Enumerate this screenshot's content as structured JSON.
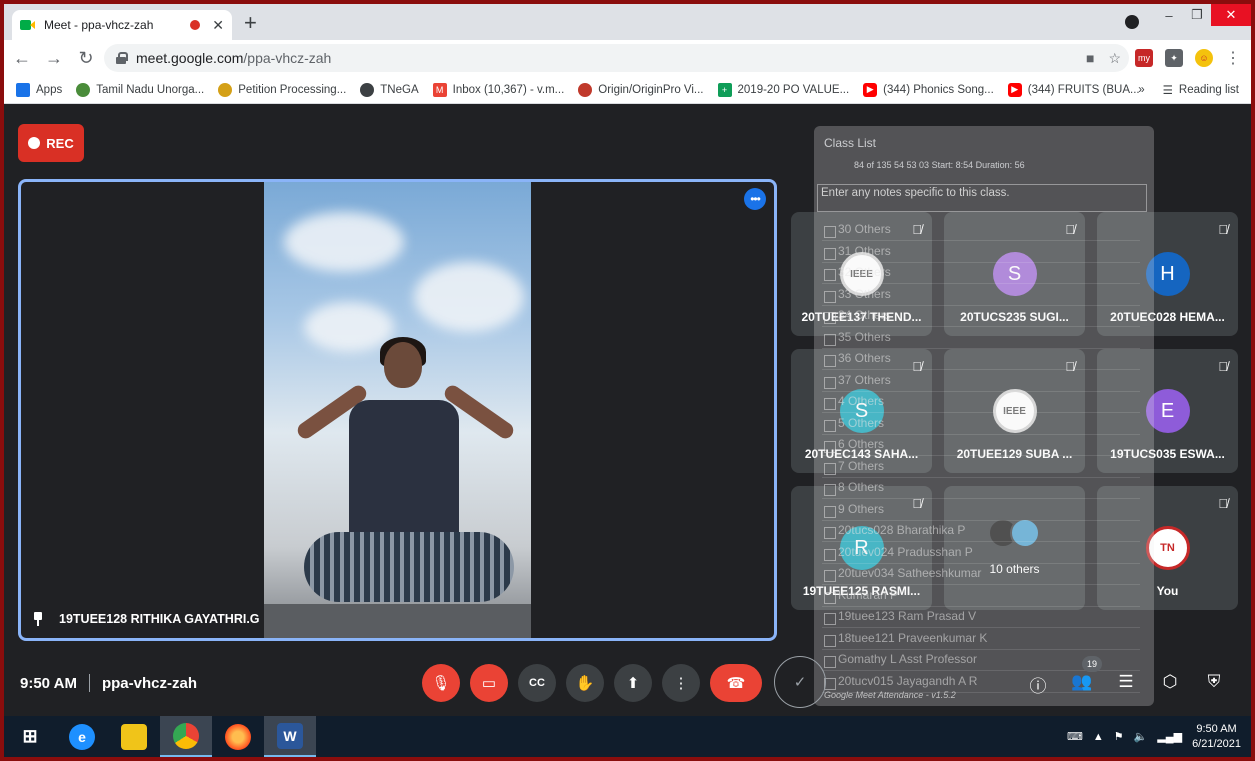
{
  "browser": {
    "tab_title": "Meet - ppa-vhcz-zah",
    "tab_close": "✕",
    "new_tab": "+",
    "url_host": "meet.google.com",
    "url_path": "/ppa-vhcz-zah",
    "win_min": "–",
    "win_max": "❐",
    "win_close": "✕",
    "nav_back": "←",
    "nav_forward": "→",
    "nav_reload": "↻",
    "omni_camera": "■",
    "omni_star": "☆",
    "menu_dots": "⋮"
  },
  "bookmarks": {
    "items": [
      {
        "label": "Apps",
        "icon": "apps-grid-icon",
        "color": "#1a73e8"
      },
      {
        "label": "Tamil Nadu Unorga...",
        "icon": "seal-icon",
        "color": "#4a8c3a"
      },
      {
        "label": "Petition Processing...",
        "icon": "seal-icon",
        "color": "#d4a017"
      },
      {
        "label": "TNeGA",
        "icon": "globe-icon",
        "color": "#3c4043"
      },
      {
        "label": "Inbox (10,367) - v.m...",
        "icon": "gmail-icon",
        "color": "#ea4335"
      },
      {
        "label": "Origin/OriginPro Vi...",
        "icon": "origin-icon",
        "color": "#c0392b"
      },
      {
        "label": "2019-20 PO VALUE...",
        "icon": "sheets-icon",
        "color": "#0f9d58"
      },
      {
        "label": "(344) Phonics Song...",
        "icon": "youtube-icon",
        "color": "#ff0000"
      },
      {
        "label": "(344) FRUITS (BUA...",
        "icon": "youtube-icon",
        "color": "#ff0000"
      }
    ],
    "more": "»",
    "reading_list": "Reading list"
  },
  "meet": {
    "rec_label": "REC",
    "main_speaker": "19TUEE128 RITHIKA GAYATHRI.G",
    "time": "9:50 AM",
    "meeting_code": "ppa-vhcz-zah",
    "participant_count": "19",
    "tiles": [
      {
        "name": "20TUEE137 THEND...",
        "avatar": "IEEE",
        "kind": "ieee",
        "color": "#ffffff"
      },
      {
        "name": "20TUCS235 SUGI...",
        "avatar": "S",
        "kind": "letter",
        "color": "#9e6bd4"
      },
      {
        "name": "20TUEC028 HEMA...",
        "avatar": "H",
        "kind": "letter",
        "color": "#1565c0"
      },
      {
        "name": "20TUEC143 SAHA...",
        "avatar": "S",
        "kind": "letter",
        "color": "#12a4b8"
      },
      {
        "name": "20TUEE129 SUBA ...",
        "avatar": "IEEE",
        "kind": "ieee",
        "color": "#ffffff"
      },
      {
        "name": "19TUCS035 ESWA...",
        "avatar": "E",
        "kind": "letter",
        "color": "#8e5cd9"
      },
      {
        "name": "19TUEE125 RASMI...",
        "avatar": "R",
        "kind": "letter",
        "color": "#12a4b8"
      },
      {
        "name": "10 others",
        "avatar": "",
        "kind": "others",
        "color": "#3c4043"
      },
      {
        "name": "You",
        "avatar": "TN",
        "kind": "you",
        "color": "#ffffff"
      }
    ]
  },
  "attendance": {
    "title": "Class List",
    "stats": "84 of 135   54   53   03   Start: 8:54   Duration: 56",
    "notes_placeholder": "Enter any notes specific to this class.",
    "rows": [
      "30 Others",
      "31 Others",
      "32 Others",
      "33 Others",
      "34 Others",
      "35 Others",
      "36 Others",
      "37 Others",
      "4 Others",
      "5 Others",
      "6 Others",
      "7 Others",
      "8 Others",
      "9 Others",
      "20tucs028 Bharathika P",
      "20tuev024 Pradusshan P",
      "20tuev034 Satheeshkumar",
      "Kumaran P",
      "19tuee123 Ram Prasad V",
      "18tuee121 Praveenkumar K",
      "Gomathy L Asst Professor",
      "20tucv015 Jayagandh A R"
    ],
    "footer": "Google Meet Attendance - v1.5.2"
  },
  "taskbar": {
    "time": "9:50 AM",
    "date": "6/21/2021"
  }
}
